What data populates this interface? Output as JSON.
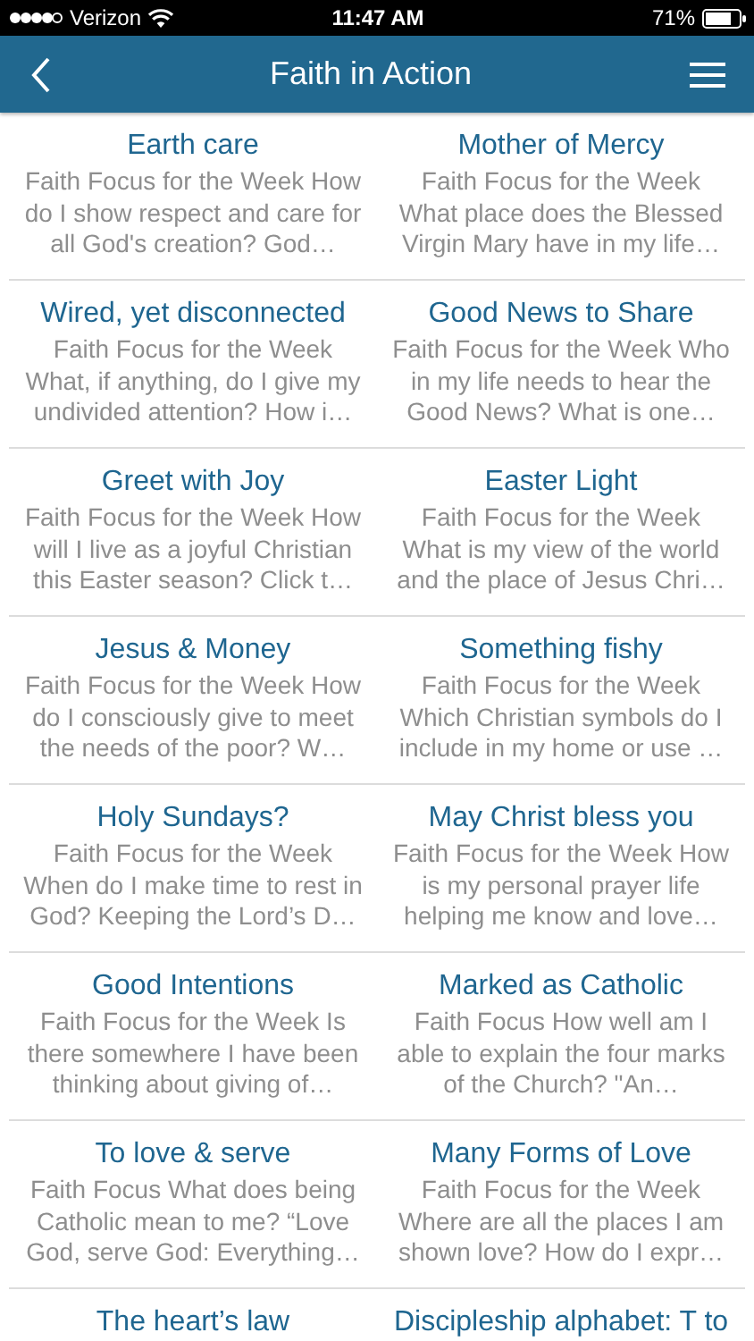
{
  "status_bar": {
    "carrier": "Verizon",
    "time": "11:47 AM",
    "battery": "71%"
  },
  "nav_bar": {
    "title": "Faith in Action"
  },
  "articles": [
    {
      "title": "Earth care",
      "lines": [
        "Faith Focus for the Week How",
        "do I show respect and care for",
        "all God's creation? God…"
      ]
    },
    {
      "title": "Mother of Mercy",
      "lines": [
        "Faith Focus for the Week",
        "What place does the Blessed",
        "Virgin Mary have in my life…"
      ]
    },
    {
      "title": "Wired, yet disconnected",
      "lines": [
        "Faith Focus for the Week",
        "What, if anything, do I give my",
        "undivided attention? How i…"
      ]
    },
    {
      "title": "Good News to Share",
      "lines": [
        "Faith Focus for the Week Who",
        "in my life needs to hear the",
        "Good News? What is one…"
      ]
    },
    {
      "title": "Greet with Joy",
      "lines": [
        "Faith Focus for the Week How",
        "will I live as a joyful Christian",
        "this Easter season? Click t…"
      ]
    },
    {
      "title": "Easter Light",
      "lines": [
        "Faith Focus for the Week",
        "What is my view of the world",
        "and the place of Jesus Chri…"
      ]
    },
    {
      "title": "Jesus & Money",
      "lines": [
        "Faith Focus for the Week How",
        "do I consciously give to meet",
        "the needs of the poor? W…"
      ]
    },
    {
      "title": "Something fishy",
      "lines": [
        "Faith Focus for the Week",
        "Which Christian symbols do I",
        "include in my home or use …"
      ]
    },
    {
      "title": "Holy Sundays?",
      "lines": [
        "Faith Focus for the Week",
        "When do I make time to rest in",
        "God?  Keeping the Lord’s D…"
      ]
    },
    {
      "title": "May Christ bless you",
      "lines": [
        "Faith Focus for the Week How",
        "is my personal prayer life",
        "helping me know and love…"
      ]
    },
    {
      "title": "Good Intentions",
      "lines": [
        "Faith Focus for the Week Is",
        "there somewhere I have been",
        "thinking about giving of…"
      ]
    },
    {
      "title": "Marked as Catholic",
      "lines": [
        "Faith Focus How well am I",
        "able to explain the four marks",
        "of the Church? \"An…"
      ]
    },
    {
      "title": "To love & serve",
      "lines": [
        "Faith Focus What does being",
        "Catholic mean to me? “Love",
        "God, serve God: Everything…"
      ]
    },
    {
      "title": "Many Forms of Love",
      "lines": [
        "Faith Focus for the Week",
        "Where are all the places I am",
        "shown love? How do I expr…"
      ]
    },
    {
      "title": "The heart’s law"
    },
    {
      "title": "Discipleship alphabet: T to"
    }
  ]
}
